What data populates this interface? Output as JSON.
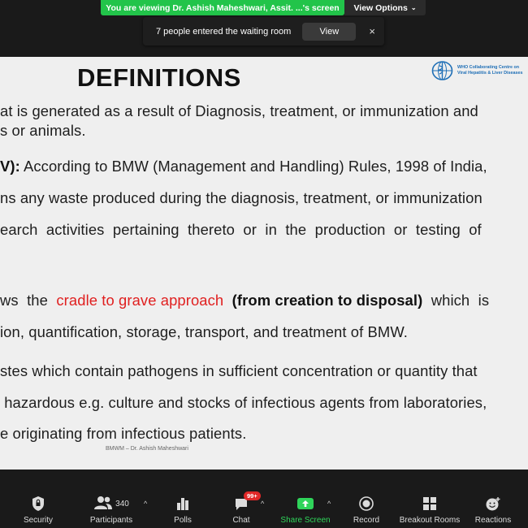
{
  "banner": {
    "sharing_text": "You are viewing Dr. Ashish Maheshwari, Assit. ...'s screen",
    "view_options_label": "View Options",
    "colors": {
      "banner": "#22c44a",
      "dark": "#2b2b2b"
    }
  },
  "notification": {
    "message": "7 people entered the waiting room",
    "view_label": "View",
    "close_glyph": "×"
  },
  "slide": {
    "title": "DEFINITIONS",
    "logo_text": [
      "WHO Collaborating Centre on",
      "Viral Hepatitis & Liver Diseases"
    ],
    "lines": [
      {
        "a": "at is generated as a result of Diagnosis, treatment, or immunization and"
      },
      {
        "a": "s or animals."
      },
      {
        "b": "V):",
        "a": " According to BMW (Management and Handling) Rules, 1998 of India,"
      },
      {
        "a": "ns any waste produced during the diagnosis, treatment, or immunization"
      },
      {
        "a": "earch  activities  pertaining  thereto  or  in  the  production  or  testing  of"
      },
      {
        "a": "ws  the  ",
        "red": "cradle to grave approach",
        "b": "  (from creation to disposal)",
        "c": "  which  is"
      },
      {
        "a": "ion, quantification, storage, transport, and treatment of BMW."
      },
      {
        "a": "stes which contain pathogens in sufficient concentration or quantity that"
      },
      {
        "a": " hazardous e.g. culture and stocks of infectious agents from laboratories,"
      },
      {
        "a": "e originating from infectious patients."
      }
    ],
    "footer": "BMWM – Dr. Ashish Maheshwari",
    "accent_color": "#e02020"
  },
  "toolbar": {
    "security": "Security",
    "participants": "Participants",
    "participants_count": "340",
    "polls": "Polls",
    "chat": "Chat",
    "chat_badge": "99+",
    "share_screen": "Share Screen",
    "record": "Record",
    "breakout_rooms": "Breakout Rooms",
    "reactions": "Reactions",
    "share_color": "#2fd45a"
  }
}
